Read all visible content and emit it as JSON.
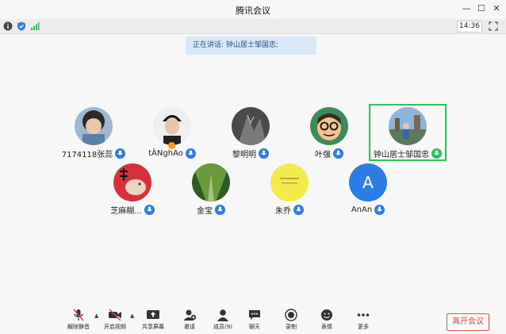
{
  "window": {
    "title": "腾讯会议"
  },
  "status": {
    "time": "14:36"
  },
  "speaking_banner": "正在讲话: 钟山居士邹国忠;",
  "participants": [
    {
      "name": "7174118张蕊",
      "mic": "blue",
      "avatar_color": "#5b7fa8"
    },
    {
      "name": "tÀNghAo",
      "mic": "blue",
      "avatar_color": "#eaeaea"
    },
    {
      "name": "黎明明",
      "mic": "blue",
      "avatar_color": "#555555"
    },
    {
      "name": "叶强",
      "mic": "blue",
      "avatar_color": "#3d8a5c"
    },
    {
      "name": "钟山居士邹国忠",
      "mic": "green",
      "avatar_color": "#7aa0c8"
    },
    {
      "name": "芝麻糊...",
      "mic": "blue",
      "avatar_color": "#d8303a"
    },
    {
      "name": "金宝",
      "mic": "blue",
      "avatar_color": "#3f6b2a"
    },
    {
      "name": "朱乔",
      "mic": "blue",
      "avatar_color": "#f4ea4a"
    },
    {
      "name": "AnAn",
      "mic": "blue",
      "avatar_color": "#2d7be5",
      "letter": "A"
    }
  ],
  "toolbar": {
    "mute": "解除静音",
    "video": "开启视频",
    "share": "共享屏幕",
    "invite": "邀请",
    "members": "成员(9)",
    "chat": "聊天",
    "record": "录制",
    "reaction": "表情",
    "more": "更多",
    "leave": "离开会议"
  },
  "colors": {
    "accent": "#2d7be5",
    "active_speaker": "#31c15a",
    "leave": "#e04040"
  }
}
